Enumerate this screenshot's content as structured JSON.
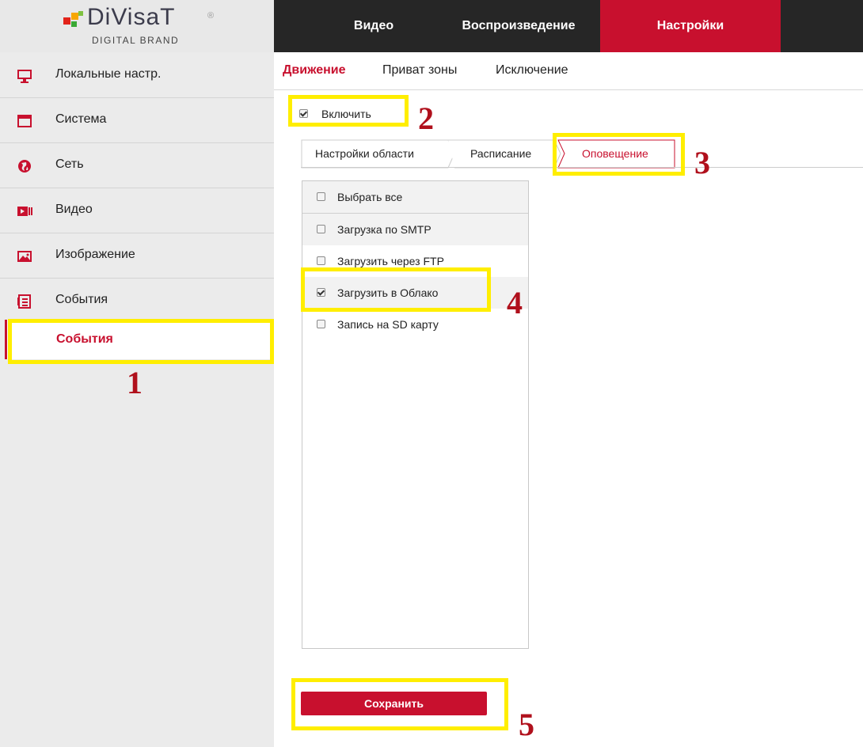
{
  "logo": {
    "brand": "DiVisaT",
    "tagline": "DIGITAL BRAND",
    "registered": "®"
  },
  "sidebar": {
    "items": [
      {
        "label": "Локальные настр.",
        "icon": "monitor-icon"
      },
      {
        "label": "Система",
        "icon": "window-icon"
      },
      {
        "label": "Сеть",
        "icon": "globe-icon"
      },
      {
        "label": "Видео",
        "icon": "video-icon"
      },
      {
        "label": "Изображение",
        "icon": "image-icon"
      },
      {
        "label": "События",
        "icon": "events-icon"
      }
    ],
    "sub_item": {
      "label": "События"
    }
  },
  "topbar": {
    "tabs": [
      {
        "label": "Видео"
      },
      {
        "label": "Воспроизведение"
      },
      {
        "label": "Настройки",
        "active": true
      }
    ]
  },
  "subtabs": [
    {
      "label": "Движение",
      "active": true
    },
    {
      "label": "Приват зоны"
    },
    {
      "label": "Исключение"
    }
  ],
  "enable": {
    "label": "Включить",
    "checked": true
  },
  "steps": [
    {
      "label": "Настройки области"
    },
    {
      "label": "Расписание"
    },
    {
      "label": "Оповещение",
      "active": true
    }
  ],
  "options": [
    {
      "label": "Выбрать все",
      "checked": false
    },
    {
      "label": "Загрузка по SMTP",
      "checked": false
    },
    {
      "label": "Загрузить через FTP",
      "checked": false
    },
    {
      "label": "Загрузить в Облако",
      "checked": true
    },
    {
      "label": "Запись на SD карту",
      "checked": false
    }
  ],
  "save_button": {
    "label": "Сохранить"
  },
  "annotations": [
    "1",
    "2",
    "3",
    "4",
    "5"
  ],
  "colors": {
    "accent": "#c8102e",
    "topbar": "#262626",
    "sidebar": "#ebebeb",
    "highlight": "#ffee00",
    "annotation_number": "#b0101c"
  }
}
